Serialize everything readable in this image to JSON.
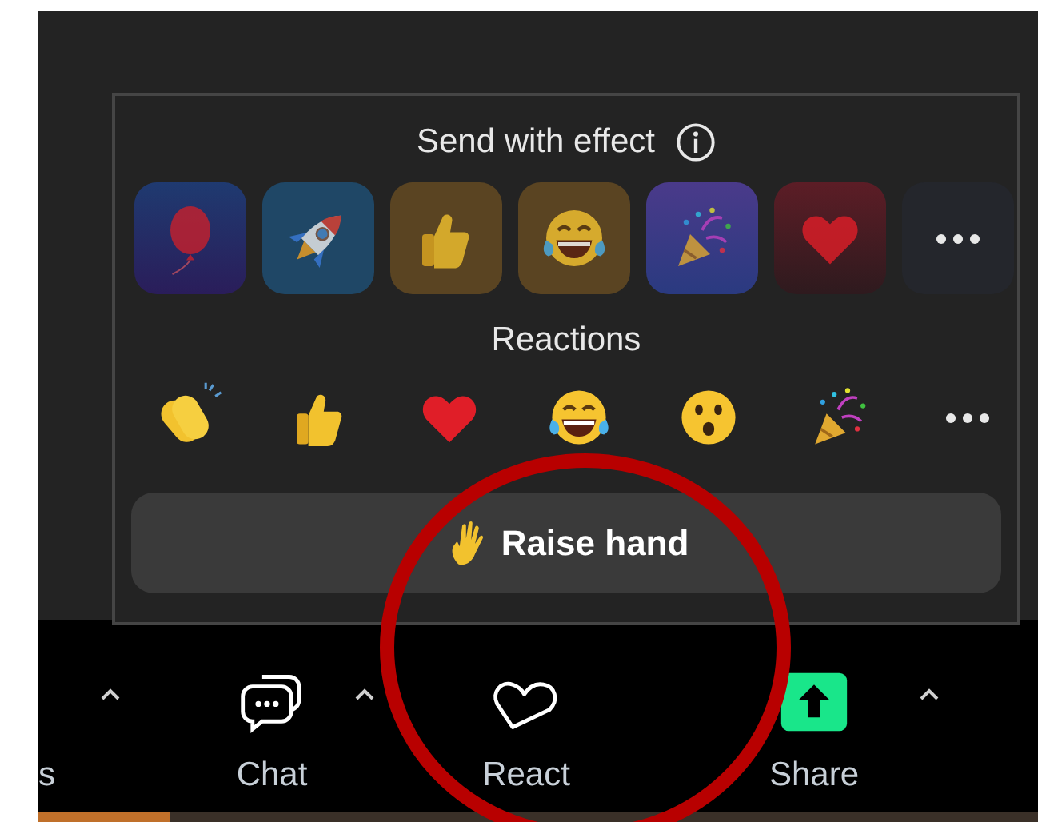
{
  "effects": {
    "title": "Send with effect",
    "items": [
      {
        "kind": "balloon"
      },
      {
        "kind": "rocket"
      },
      {
        "kind": "thumbs-up"
      },
      {
        "kind": "laughing"
      },
      {
        "kind": "party"
      },
      {
        "kind": "heart"
      },
      {
        "kind": "more"
      }
    ]
  },
  "reactions": {
    "title": "Reactions",
    "items": [
      {
        "kind": "clap"
      },
      {
        "kind": "thumbs-up"
      },
      {
        "kind": "heart"
      },
      {
        "kind": "laughing"
      },
      {
        "kind": "surprised"
      },
      {
        "kind": "party"
      },
      {
        "kind": "more"
      }
    ]
  },
  "raise_hand": {
    "label": "Raise hand"
  },
  "toolbar": {
    "items": [
      {
        "kind": "cut",
        "label": "s",
        "caret": true
      },
      {
        "kind": "chat",
        "label": "Chat",
        "caret": true
      },
      {
        "kind": "react",
        "label": "React",
        "caret": false
      },
      {
        "kind": "share",
        "label": "Share",
        "caret": true
      }
    ]
  }
}
